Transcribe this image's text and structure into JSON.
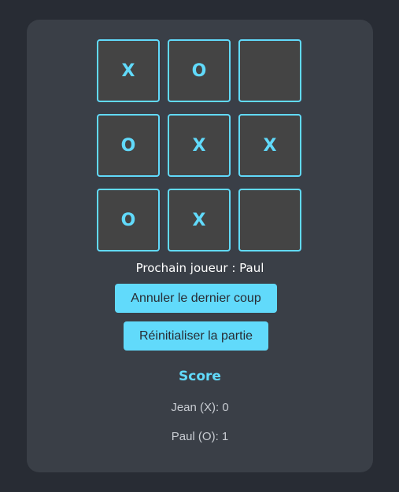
{
  "board": {
    "cells": [
      "X",
      "O",
      "",
      "O",
      "X",
      "X",
      "O",
      "X",
      ""
    ]
  },
  "status": {
    "text": "Prochain joueur : Paul"
  },
  "buttons": {
    "undo_label": "Annuler le dernier coup",
    "reset_label": "Réinitialiser la partie"
  },
  "score": {
    "title": "Score",
    "player_x": "Jean (X): 0",
    "player_o": "Paul (O): 1"
  },
  "colors": {
    "background": "#282c34",
    "panel": "#3a3f47",
    "cell": "#444444",
    "accent": "#61dafb"
  }
}
